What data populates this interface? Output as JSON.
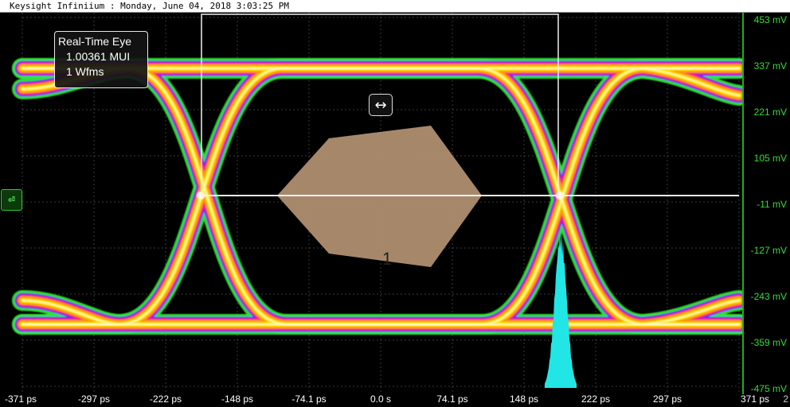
{
  "window": {
    "title": "Keysight Infiniium : Monday, June 04, 2018 3:03:25 PM"
  },
  "eye_info": {
    "title": "Real-Time Eye",
    "mui": "1.00361 MUI",
    "wfms": "1 Wfms"
  },
  "mask": {
    "label": "1",
    "color": "#b08e70"
  },
  "channel_marker": {
    "icon": "channel-ground-marker-icon"
  },
  "colors": {
    "background": "#000000",
    "grid": "#3a3a3a",
    "axis_text_y": "#33dd33",
    "axis_text_x": "#ffffff",
    "histogram": "#22e6e6",
    "eye_hot": "#ffffff",
    "eye_core": "#ffe000",
    "eye_mid": "#ff9a00",
    "eye_outer": "#ff2080",
    "eye_edge": "#6a2cff",
    "eye_fringe": "#2ee82e"
  },
  "y_axis": {
    "labels": [
      "453 mV",
      "337 mV",
      "221 mV",
      "105 mV",
      "-11 mV",
      "-127 mV",
      "-243 mV",
      "-359 mV",
      "-475 mV"
    ]
  },
  "x_axis": {
    "labels": [
      "-371 ps",
      "-297 ps",
      "-222 ps",
      "-148 ps",
      "-74.1 ps",
      "0.0 s",
      "74.1 ps",
      "148 ps",
      "222 ps",
      "297 ps",
      "371 ps"
    ],
    "page": "2"
  }
}
